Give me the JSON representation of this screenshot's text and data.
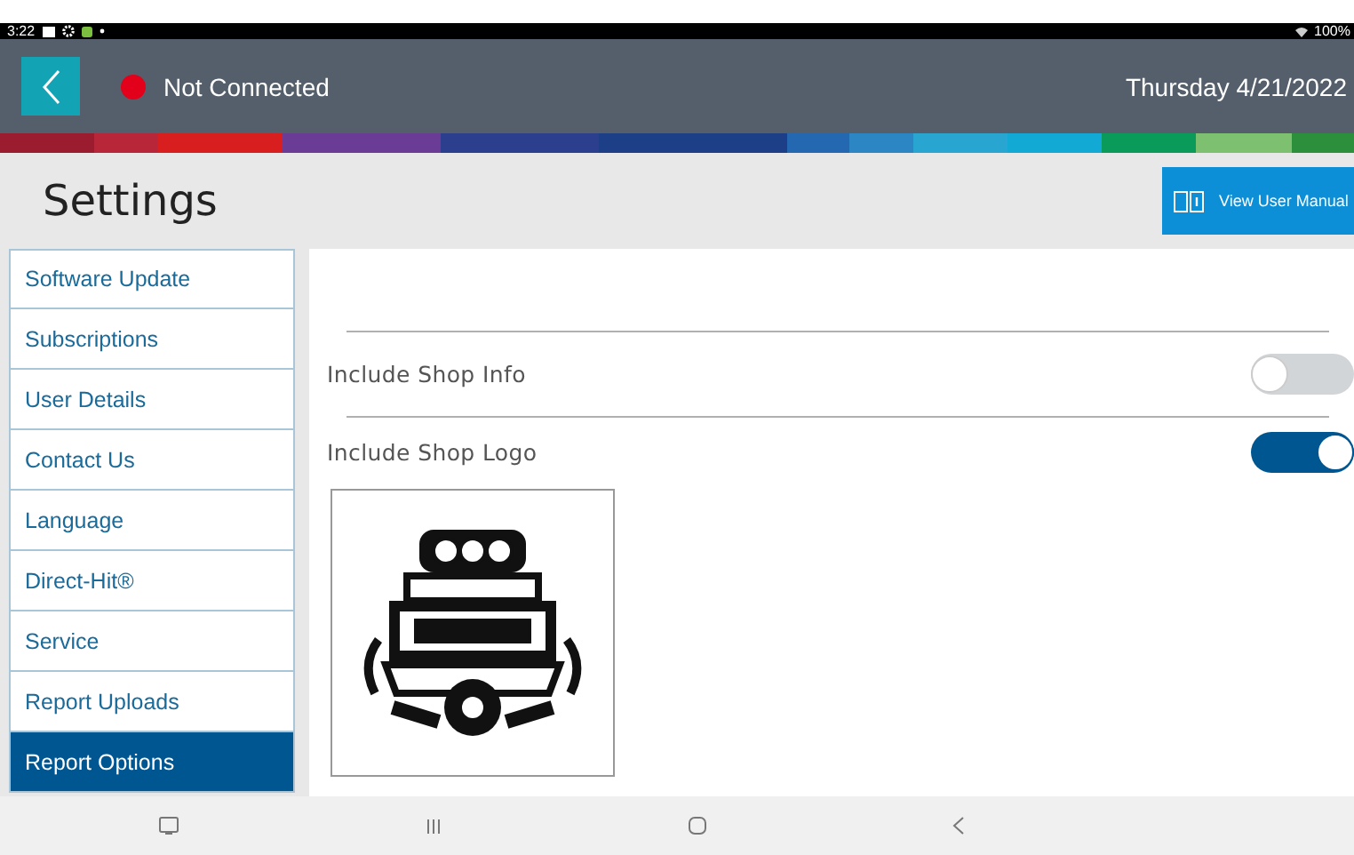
{
  "status_bar": {
    "time": "3:22",
    "battery": "100%"
  },
  "header": {
    "connection": {
      "label": "Not Connected",
      "connected": false
    },
    "date": "Thursday 4/21/2022"
  },
  "page": {
    "title": "Settings",
    "manual_button": "View User Manual"
  },
  "sidebar": {
    "items": [
      {
        "label": "Software Update",
        "selected": false
      },
      {
        "label": "Subscriptions",
        "selected": false
      },
      {
        "label": "User Details",
        "selected": false
      },
      {
        "label": "Contact Us",
        "selected": false
      },
      {
        "label": "Language",
        "selected": false
      },
      {
        "label": "Direct-Hit®",
        "selected": false
      },
      {
        "label": "Service",
        "selected": false
      },
      {
        "label": "Report Uploads",
        "selected": false
      },
      {
        "label": "Report Options",
        "selected": true
      }
    ]
  },
  "options": [
    {
      "label": "Include Shop Info",
      "on": false
    },
    {
      "label": "Include Shop Logo",
      "on": true
    }
  ]
}
